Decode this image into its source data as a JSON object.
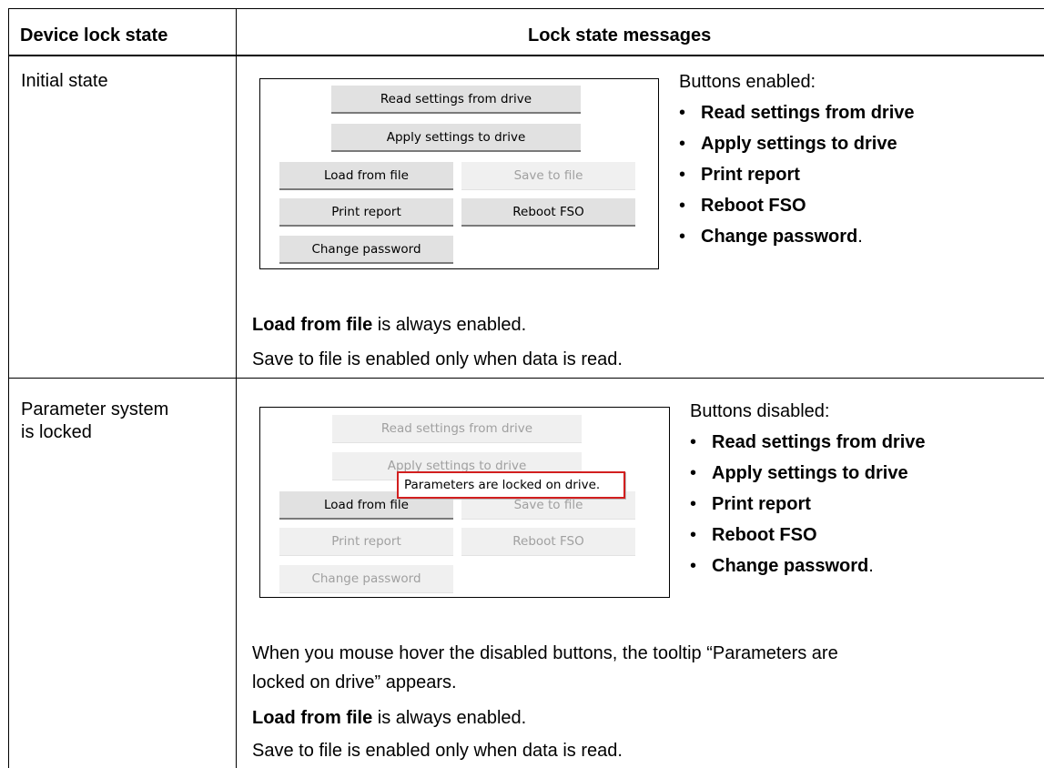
{
  "header": {
    "col1": "Device lock state",
    "col2": "Lock state messages"
  },
  "rows": [
    {
      "state": "Initial state",
      "panel": {
        "read": "Read settings from drive",
        "apply": "Apply settings to drive",
        "load": "Load from file",
        "save": "Save to file",
        "print": "Print report",
        "reboot": "Reboot FSO",
        "change_pw": "Change password"
      },
      "list_title": "Buttons enabled:",
      "list_items": [
        "Read settings from drive",
        "Apply settings to drive",
        "Print report",
        "Reboot FSO",
        "Change password"
      ],
      "list_end": ".",
      "load_note_bold": "Load from file",
      "load_note_rest": " is always enabled.",
      "save_note": "Save to file is enabled only when data is read."
    },
    {
      "state_line1": "Parameter system",
      "state_line2": "is locked",
      "panel": {
        "read": "Read settings from drive",
        "apply": "Apply settings to drive",
        "load": "Load from file",
        "save": "Save to file",
        "print": "Print report",
        "reboot": "Reboot FSO",
        "change_pw": "Change password",
        "tooltip": "Parameters are locked on drive."
      },
      "list_title": "Buttons disabled:",
      "list_items": [
        "Read settings from drive",
        "Apply settings to drive",
        "Print report",
        "Reboot FSO",
        "Change password"
      ],
      "list_end": ".",
      "hover_line1": "When you mouse hover the disabled buttons, the tooltip “Parameters are",
      "hover_line2": "locked on drive” appears.",
      "load_note_bold": "Load from file",
      "load_note_rest": " is always enabled.",
      "save_note": "Save to file is enabled only when data is read."
    }
  ],
  "bullet": "•"
}
